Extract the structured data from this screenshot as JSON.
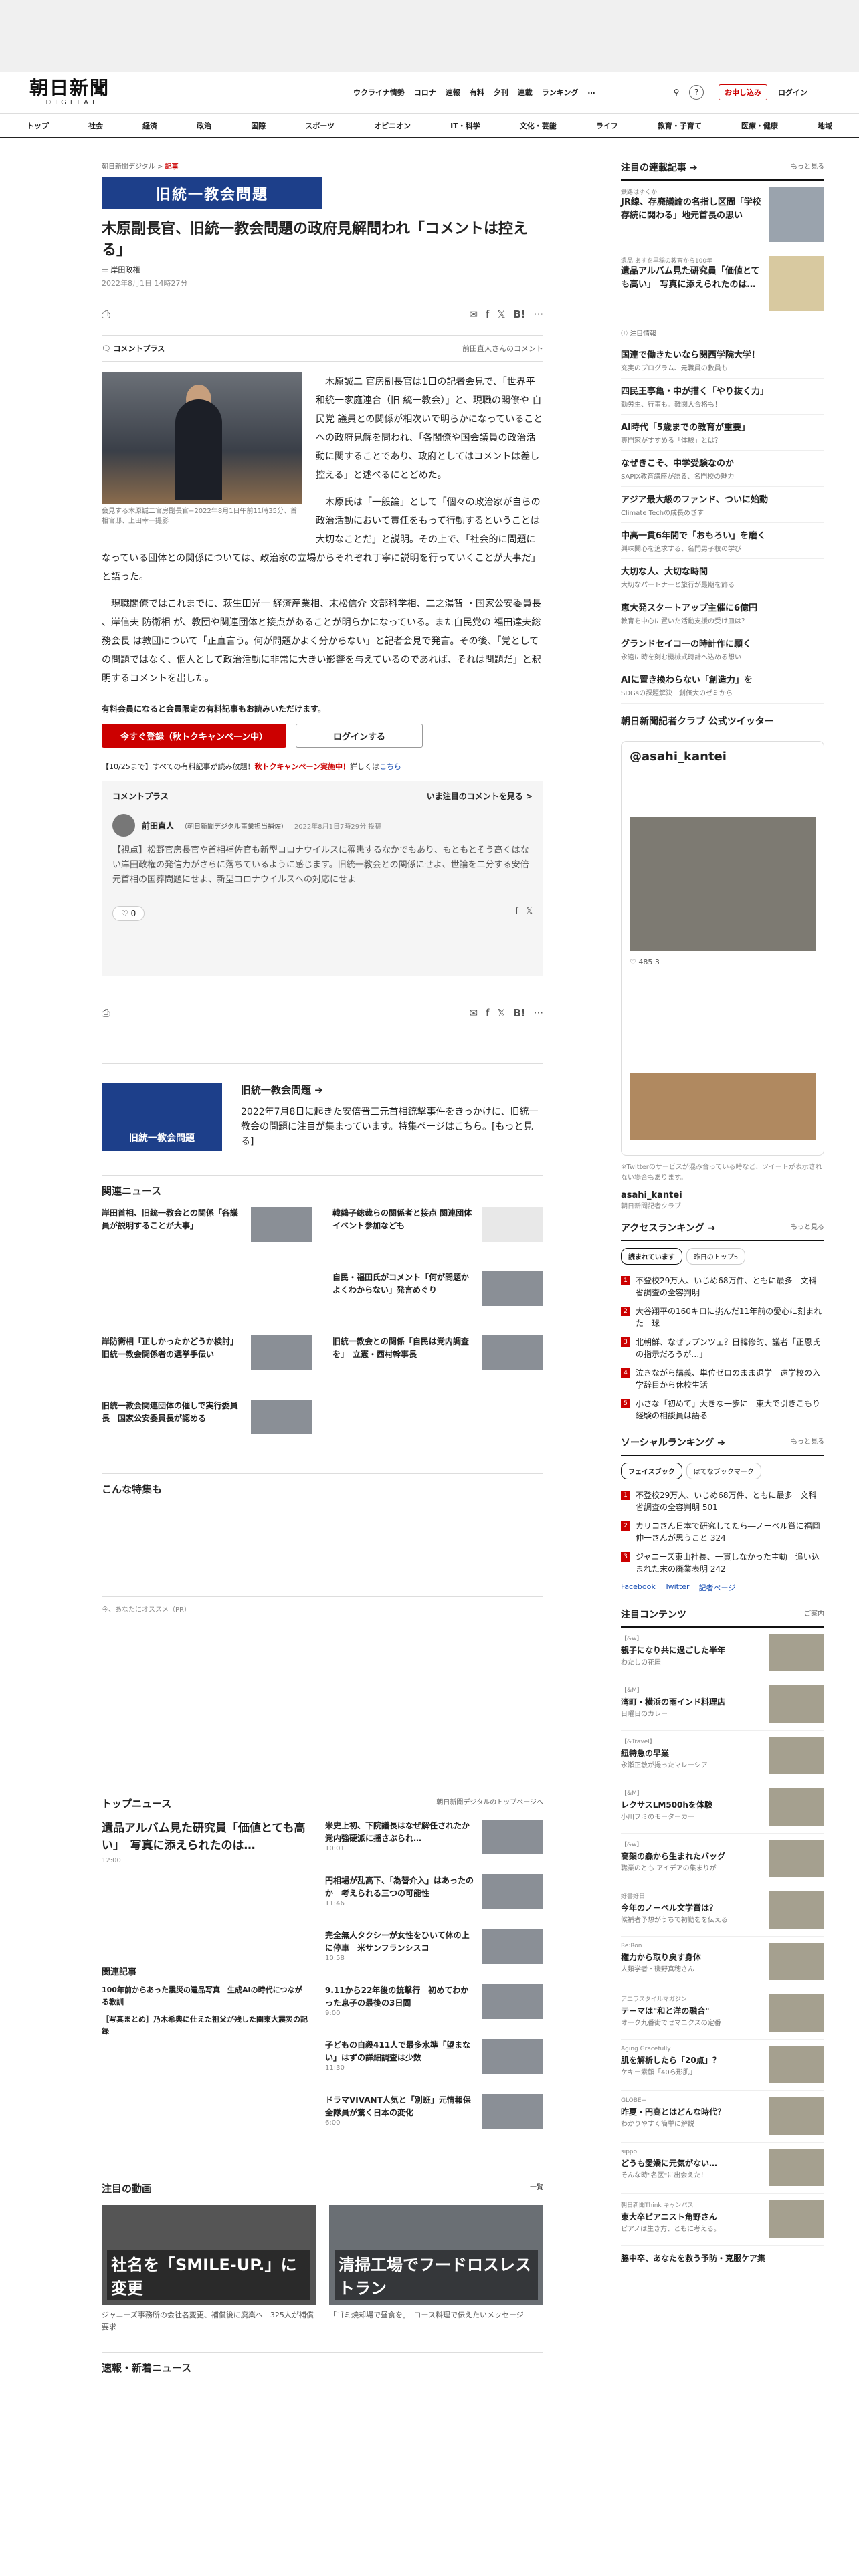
{
  "header": {
    "logo_main": "朝日新聞",
    "logo_sub": "DIGITAL",
    "nav": [
      "ウクライナ情勢",
      "コロナ",
      "速報",
      "有料",
      "夕刊",
      "連載",
      "ランキング",
      "…"
    ],
    "apply": "お申し込み",
    "login": "ログイン"
  },
  "cats": [
    "トップ",
    "社会",
    "経済",
    "政治",
    "国際",
    "スポーツ",
    "オピニオン",
    "IT・科学",
    "文化・芸能",
    "ライフ",
    "教育・子育て",
    "医療・健康",
    "地域"
  ],
  "article": {
    "breadcrumb_site": "朝日新聞デジタル",
    "breadcrumb_sep": ">",
    "breadcrumb_cat": "記事",
    "banner": "旧統一教会問題",
    "title": "木原副長官、旧統一教会問題の政府見解問われ「コメントは控える」",
    "author": "岸田政権",
    "date": "2022年8月1日 14時27分",
    "comment_plus": "コメントプラス",
    "commenter_note": "前田直人さんのコメント",
    "photo_caption": "会見する木原誠二官房副長官=2022年8月1日午前11時35分、首相官邸、上田幸一撮影",
    "paras": [
      "木原誠二 官房副長官は1日の記者会見で、「世界平和統一家庭連合（旧 統一教会）」と、現職の閣僚や 自民党 議員との関係が相次いで明らかになっていることへの政府見解を問われ、「各閣僚や国会議員の政治活動に関することであり、政府としてはコメントは差し控える」と述べるにとどめた。",
      "木原氏は「一般論」として「個々の政治家が自らの政治活動において責任をもって行動するということは大切なことだ」と説明。その上で、「社会的に問題になっている団体との関係については、政治家の立場からそれぞれ丁寧に説明を行っていくことが大事だ」と語った。",
      "現職閣僚ではこれまでに、萩生田光一 経済産業相、末松信介 文部科学相、二之湯智 ・国家公安委員長 、岸信夫 防衛相 が、教団や関連団体と接点があることが明らかになっている。また自民党の 福田達夫総務会長 は教団について「正直言う。何が問題かよく分からない」と記者会見で発言。その後、「党としての問題ではなく、個人として政治活動に非常に大きい影響を与えているのであれば、それは問題だ」と釈明するコメントを出した。"
    ],
    "pay_text": "有料会員になると会員限定の有料記事もお読みいただけます。",
    "register_btn": "今すぐ登録（秋トクキャンペーン中）",
    "login_btn": "ログインする",
    "campaign_pre": "【10/25まで】すべての有料記事が読み放題！",
    "campaign_red": "秋トクキャンペーン実施中！",
    "campaign_post": "詳しくは",
    "campaign_link": "こちら",
    "likes": "0"
  },
  "commentbox": {
    "title": "コメントプラス",
    "more": "いま注目のコメントを見る >",
    "name": "前田直人",
    "role": "（朝日新聞デジタル事業担当補佐）",
    "time": "2022年8月1日7時29分 投稿",
    "text": "【視点】松野官房長官や首相補佐官も新型コロナウイルスに罹患するなかでもあり、もともとそう高くはない岸田政権の発信力がさらに落ちているように感じます。旧統一教会との関係にせよ、世論を二分する安倍元首相の国葬問題にせよ、新型コロナウイルスへの対応にせよ"
  },
  "feature": {
    "img": "旧統一教会問題",
    "title": "旧統一教会問題 ➔",
    "desc": "2022年7月8日に起きた安倍晋三元首相銃撃事件をきっかけに、旧統一教会の問題に注目が集まっています。特集ページはこちら。[もっと見る]"
  },
  "related_title": "関連ニュース",
  "related": [
    "岸田首相、旧統一教会との関係「各議員が説明することが大事」",
    "韓鶴子総裁らの関係者と接点 関連団体イベント参加なども",
    "",
    "自民・福田氏がコメント「何が問題かよくわからない」発言めぐり",
    "岸防衛相「正しかったかどうか検討」 旧統一教会関係者の選挙手伝い",
    "旧統一教会との関係「自民は党内調査を」　立憲・西村幹事長",
    "旧統一教会関連団体の催しで実行委員長　国家公安委員長が認める"
  ],
  "special_title": "こんな特集も",
  "reco_label": "今、あなたにオススメ（PR）",
  "topnews": {
    "title": "トップニュース",
    "link": "朝日新聞デジタルのトップページへ",
    "lead": "遺品アルバム見た研究員「価値とても高い」　写真に添えられたのは…",
    "lead_time": "12:00",
    "items": [
      {
        "t": "米史上初、下院議長はなぜ解任されたか　党内強硬派に揺さぶられ…",
        "m": "10:01"
      },
      {
        "t": "円相場が乱高下、「為替介入」はあったのか　考えられる三つの可能性",
        "m": "11:46"
      },
      {
        "t": "完全無人タクシーが女性をひいて体の上に停車　米サンフランシスコ",
        "m": "10:58"
      },
      {
        "t": "9.11から22年後の銃撃行　初めてわかった息子の最後の3日間",
        "m": "9:00"
      },
      {
        "t": "子どもの自殺411人で最多水準「望まない」はずの詳細調査は少数",
        "m": "11:30"
      },
      {
        "t": "ドラマVIVANT人気と「別班」元情報保全隊員が驚く日本の変化",
        "m": "6:00"
      }
    ],
    "rel_title": "関連記事",
    "rel": [
      "100年前からあった震災の遺品写真　生成AIの時代につながる教訓",
      "［写真まとめ］乃木希典に仕えた祖父が残した関東大震災の記録"
    ]
  },
  "videos_title": "注目の動画",
  "videos_more": "一覧",
  "videos": [
    {
      "ov": "社名を「SMILE-UP.」に変更",
      "cap": "ジャニーズ事務所の会社名変更、補償後に廃業へ　325人が補償要求"
    },
    {
      "ov": "清掃工場でフードロスレストラン",
      "cap": "「ゴミ焼却場で昼食を」　コース料理で伝えたいメッセージ"
    }
  ],
  "breaking_title": "速報・新着ニュース",
  "side": {
    "pickup_title": "注目の連載記事 ➔",
    "pickup_more": "もっと見る",
    "pickup": [
      {
        "lab": "鉄路はゆくか",
        "ti": "JR線、存廃議論の名指し区間「学校存続に関わる」地元首長の思い"
      },
      {
        "lab": "遺品 あすを早稲の教育から100年",
        "ti": "遺品アルバム見た研究員「価値とても高い」　写真に添えられたのは…"
      }
    ],
    "ad_label": "注目情報",
    "ads": [
      {
        "ti": "国連で働きたいなら関西学院大学！",
        "sb": "充実のプログラム、元職員の教員も"
      },
      {
        "ti": "四民王亭亀・中が描く「やり抜く力」",
        "sb": "勤労生、行事も。難関大合格も！"
      },
      {
        "ti": "AI時代「5歳までの教育が重要」",
        "sb": "専門家がすすめる「体験」とは？"
      },
      {
        "ti": "なぜきこそ、中学受験なのか",
        "sb": "SAPIX教育講座が語る、名門校の魅力"
      },
      {
        "ti": "アジア最大級のファンド、ついに始動",
        "sb": "Climate Techの成長めざす"
      },
      {
        "ti": "中高一貫6年間で「おもろい」を磨く",
        "sb": "興味関心を追求する、名門男子校の学び"
      },
      {
        "ti": "大切な人、大切な時間",
        "sb": "大切なパートナーと旅行が最期を飾る"
      },
      {
        "ti": "恵大発スタートアップ主催に6億円",
        "sb": "教育を中心に置いた活動支援の受け皿は？"
      },
      {
        "ti": "グランドセイコーの時計作に願く",
        "sb": "永遠に時を刻む機械式時計へ込める想い"
      },
      {
        "ti": "AIに置き換わらない「創造力」を",
        "sb": "SDGsの課題解決　創価大のゼミから"
      }
    ],
    "club_title": "朝日新聞記者クラブ 公式ツイッター",
    "twitter_handle": "@asahi_kantei",
    "tweet_stats": "485  3",
    "tw_note": "※Twitterのサービスが混み合っている時など、ツイートが表示されない場合もあります。",
    "tw_account": "asahi_kantei",
    "tw_account_sub": "朝日新聞記者クラブ",
    "access_title": "アクセスランキング ➔",
    "access_more": "もっと見る",
    "tabs": [
      "読まれています",
      "昨日のトップ5"
    ],
    "ranking": [
      "不登校29万人、いじめ68万件、ともに最多　文科省調査の全容判明",
      "大谷翔平の160キロに挑んだ11年前の愛心に刻まれた一球",
      "北朝鮮、なぜラプンツェ？日韓修的、議者「正恩氏の指示だろうが…」",
      "泣きながら講義、単位ゼロのまま退学　遠学校の入学辞目から休校生活",
      "小さな「初めて」大きな一歩に　東大で引きこもり経験の相談員は語る"
    ],
    "social_title": "ソーシャルランキング ➔",
    "social_tabs": [
      "フェイスブック",
      "はてなブックマーク"
    ],
    "social": [
      "不登校29万人、いじめ68万件、ともに最多　文科省調査の全容判明 501",
      "カリコさん日本で研究してたら―ノーベル賞に福岡伸一さんが思うこと 324",
      "ジャニーズ東山社長、一貫しなかった主動　追い込まれた末の廃業表明 242"
    ],
    "social_links": [
      "Facebook",
      "Twitter",
      "記者ページ"
    ],
    "contents_title": "注目コンテンツ",
    "contents_more": "ご案内",
    "contents": [
      {
        "lab": "【&w】",
        "ti": "親子になり共に過ごした半年",
        "sb": "わたしの花屋"
      },
      {
        "lab": "【&M】",
        "ti": "湾町・横浜の雨インド料理店",
        "sb": "日曜日のカレー"
      },
      {
        "lab": "【&Travel】",
        "ti": "紐特急の早業",
        "sb": "永瀬正敏が撮ったマレーシア"
      },
      {
        "lab": "【&M】",
        "ti": "レクサスLM500hを体験",
        "sb": "小川フミのモーターカー"
      },
      {
        "lab": "【&w】",
        "ti": "高架の森から生まれたバッグ",
        "sb": "職業のとも アイデアの集まりが"
      },
      {
        "lab": "好書好日",
        "ti": "今年のノーベル文学賞は？",
        "sb": "候補者予想がうちで初勤をを伝える"
      },
      {
        "lab": "Re:Ron",
        "ti": "権力から取り戻す身体",
        "sb": "人類学者・磯野真穂さん"
      },
      {
        "lab": "アエラスタイルマガジン",
        "ti": "テーマは\"和と洋の融合\"",
        "sb": "オーク九番街でセマニクスの定番"
      },
      {
        "lab": "Aging Gracefully",
        "ti": "肌を解析したら「20点」？",
        "sb": "ケキー素顔「40ら形肌」"
      },
      {
        "lab": "GLOBE+",
        "ti": "昨夏・円高とはどんな時代？",
        "sb": "わかりやすく簡単に解説"
      },
      {
        "lab": "sippo",
        "ti": "どうも愛嬌に元気がない…",
        "sb": "そんな時\"名医\"に出会えた！"
      },
      {
        "lab": "朝日新聞Think キャンパス",
        "ti": "東大卒ピアニスト角野さん",
        "sb": "ピアノは生き方、ともに考える。"
      }
    ],
    "last": "脇中卒、あなたを救う予防・克服ケア集"
  }
}
